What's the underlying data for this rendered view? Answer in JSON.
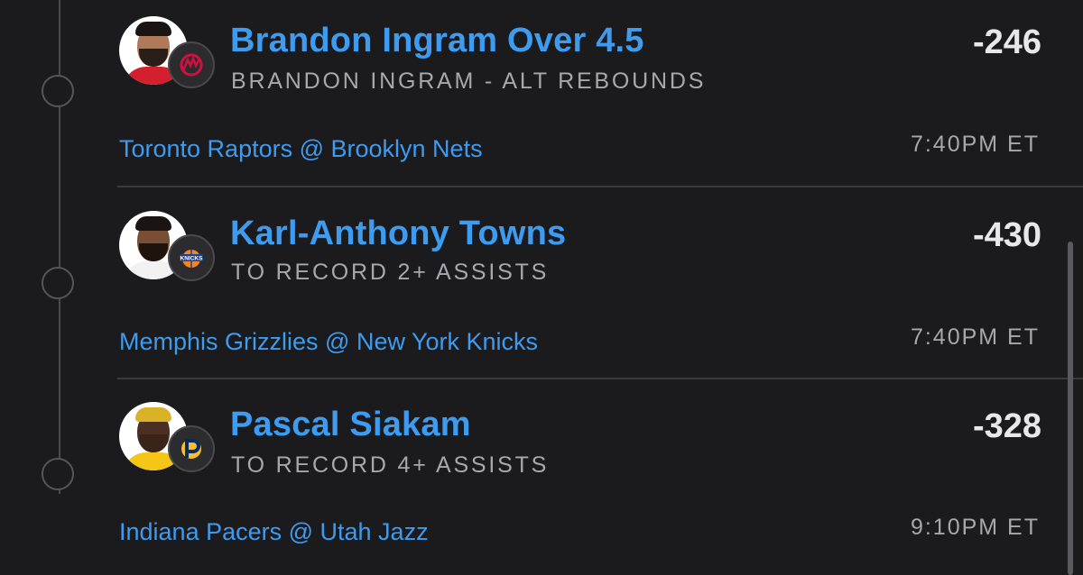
{
  "legs": [
    {
      "title": "Brandon Ingram Over 4.5",
      "market": "BRANDON INGRAM - ALT REBOUNDS",
      "odds": "-246",
      "matchup": "Toronto Raptors @ Brooklyn Nets",
      "time": "7:40PM ET",
      "team_icon": "raptors-logo-icon",
      "jersey_color": "#d4202e",
      "skin_color": "#b07a5a"
    },
    {
      "title": "Karl-Anthony Towns",
      "market": "TO RECORD 2+ ASSISTS",
      "odds": "-430",
      "matchup": "Memphis Grizzlies @ New York Knicks",
      "time": "7:40PM ET",
      "team_icon": "knicks-logo-icon",
      "jersey_color": "#f2f2f2",
      "skin_color": "#7a4e34"
    },
    {
      "title": "Pascal Siakam",
      "market": "TO RECORD 4+ ASSISTS",
      "odds": "-328",
      "matchup": "Indiana Pacers @ Utah Jazz",
      "time": "9:10PM ET",
      "team_icon": "pacers-logo-icon",
      "jersey_color": "#f5c518",
      "skin_color": "#4a2f22"
    }
  ]
}
